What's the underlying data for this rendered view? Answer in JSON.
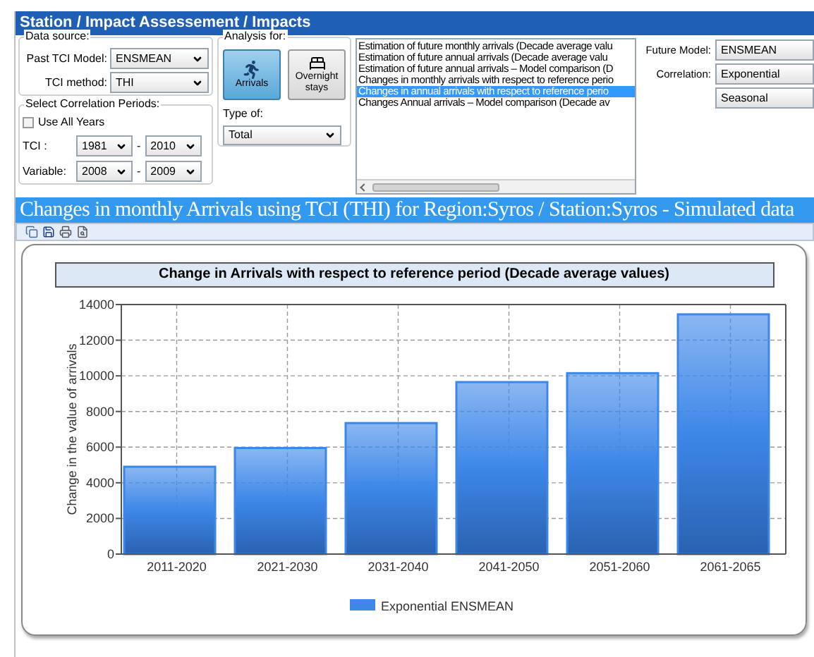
{
  "breadcrumb": "Station / Impact Assessement /  Impacts",
  "data_source": {
    "label": "Data source:",
    "past_tci_model": {
      "label": "Past TCI Model:",
      "value": "ENSMEAN"
    },
    "tci_method": {
      "label": "TCI method:",
      "value": "THI"
    }
  },
  "correlation_periods": {
    "label": "Select Correlation Periods:",
    "use_all_years": {
      "label": "Use All Years",
      "checked": false
    },
    "rows": [
      {
        "label": "TCI :",
        "from": "1981",
        "separator": "-",
        "to": "2010"
      },
      {
        "label": "Variable:",
        "from": "2008",
        "separator": "-",
        "to": "2009"
      }
    ]
  },
  "analysis": {
    "label": "Analysis for:",
    "buttons": [
      {
        "label": "Arrivals",
        "selected": true,
        "kind": "arrivals"
      },
      {
        "label": "Overnight stays",
        "selected": false,
        "kind": "stays"
      }
    ],
    "type_of": {
      "label": "Type of:",
      "value": "Total"
    }
  },
  "reports": [
    {
      "label": "Estimation of future monthly arrivals (Decade average valu",
      "selected": false
    },
    {
      "label": "Estimation of future annual arrivals (Decade average valu",
      "selected": false
    },
    {
      "label": "Estimation of future annual arrivals – Model comparison (D",
      "selected": false
    },
    {
      "label": "Changes in monthly arrivals with respect to reference perio",
      "selected": false
    },
    {
      "label": "Changes in annual arrivals with respect to reference perio",
      "selected": true
    },
    {
      "label": "Changes Annual arrivals – Model comparison (Decade av",
      "selected": false
    }
  ],
  "future_model": {
    "label": "Future Model:",
    "value": "ENSMEAN"
  },
  "correlation": {
    "label": "Correlation:",
    "value": "Exponential"
  },
  "season": {
    "value": "Seasonal"
  },
  "results_title": "Changes in monthly Arrivals using TCI (THI) for Region:Syros / Station:Syros - Simulated data",
  "chart": {
    "chart_data": {
      "type": "bar",
      "title": "Change in Arrivals with respect to reference period (Decade average values)",
      "ylabel": "Change in the value of arrivals",
      "categories": [
        "2011-2020",
        "2021-2030",
        "2031-2040",
        "2041-2050",
        "2051-2060",
        "2061-2065"
      ],
      "series": [
        {
          "name": "Exponential ENSMEAN",
          "color": "#3d87e8",
          "values": [
            4900,
            5950,
            7350,
            9650,
            10150,
            13450
          ]
        }
      ],
      "grid": true,
      "ylim": [
        0,
        14000
      ],
      "yticks": [
        0,
        2000,
        4000,
        6000,
        8000,
        10000,
        12000,
        14000
      ]
    }
  }
}
